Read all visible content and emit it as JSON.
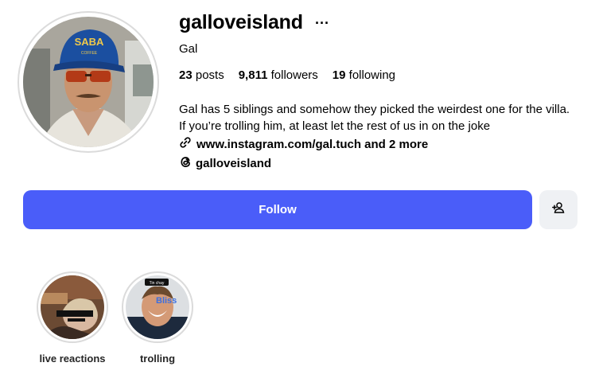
{
  "profile": {
    "username": "galloveisland",
    "more_icon": "···",
    "full_name": "Gal",
    "stats": {
      "posts_count": "23",
      "posts_label": "posts",
      "followers_count": "9,811",
      "followers_label": "followers",
      "following_count": "19",
      "following_label": "following"
    },
    "bio": "Gal has 5 siblings and somehow they picked the weirdest one for the villa. If you’re trolling him, at least let the rest of us in on the joke",
    "link_text": "www.instagram.com/gal.tuch and 2 more",
    "threads_handle": "galloveisland",
    "avatar_cap_text": "SABA"
  },
  "actions": {
    "follow_label": "Follow",
    "suggest_icon": "person-add-icon"
  },
  "highlights": [
    {
      "label": "live reactions"
    },
    {
      "label": "trolling",
      "thumb_caption": "Tin chay"
    }
  ],
  "colors": {
    "accent": "#4a5df9",
    "secondary_button": "#eff1f4",
    "ring": "#dbdbdb"
  }
}
